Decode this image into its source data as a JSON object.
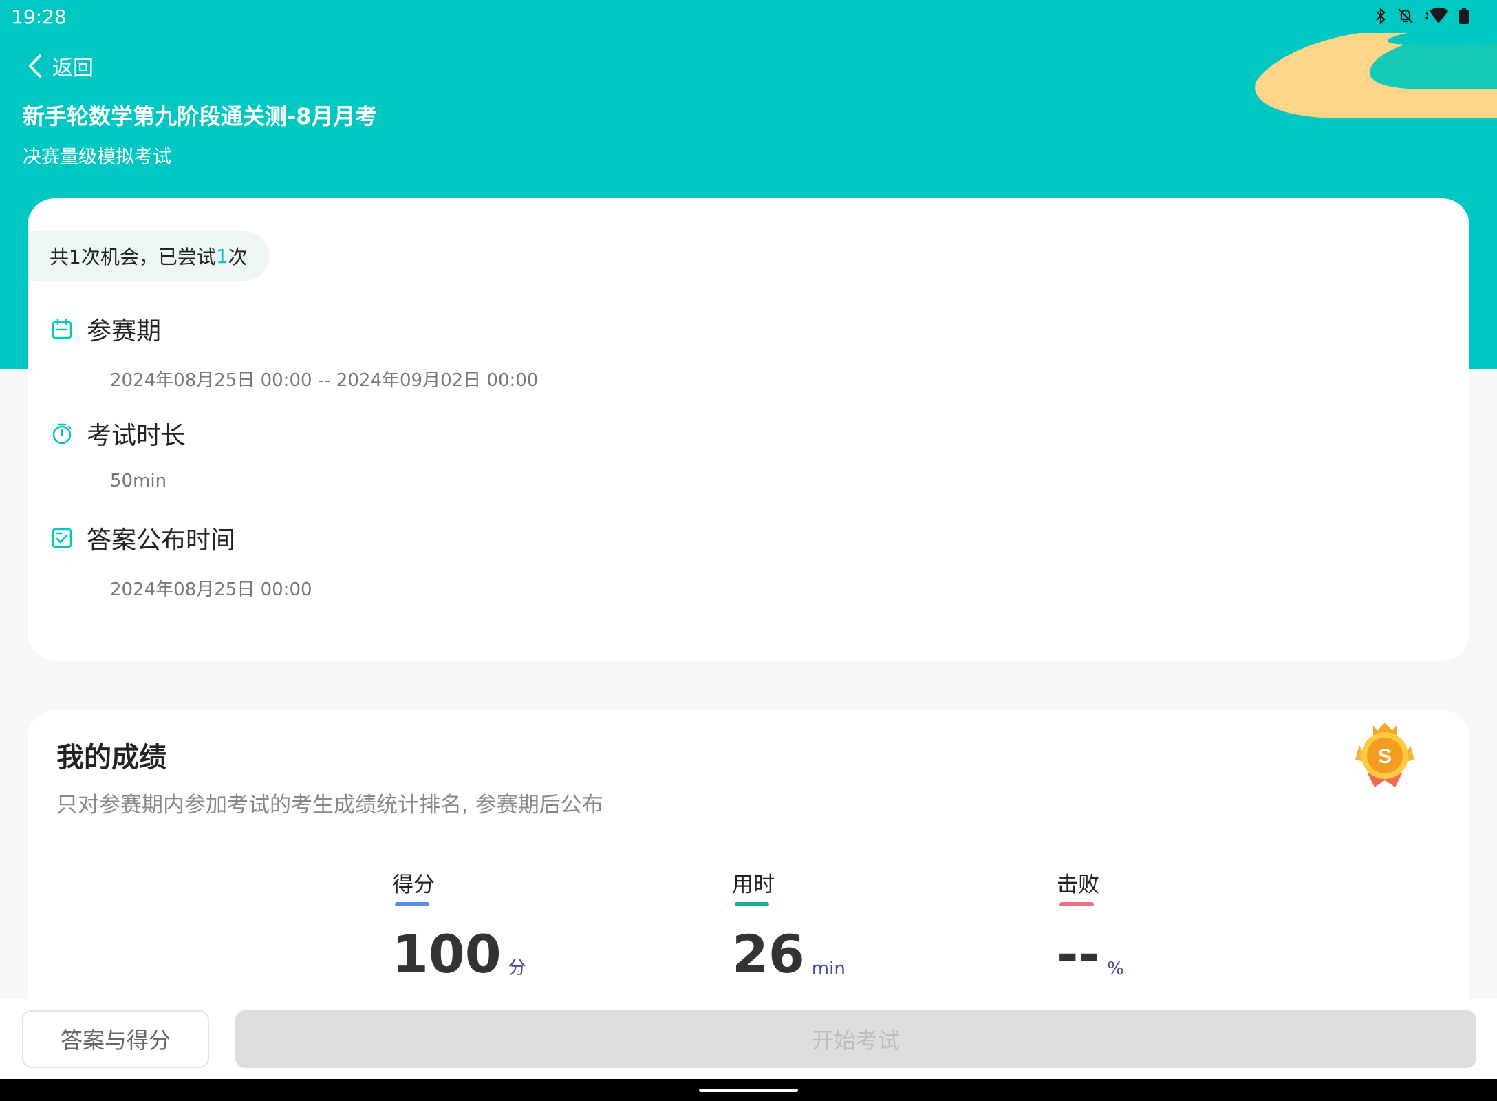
{
  "status_bar": {
    "time": "19:28",
    "icons": [
      "bluetooth-icon",
      "notifications-off-icon",
      "wifi-icon",
      "battery-icon"
    ]
  },
  "nav": {
    "back_label": "返回"
  },
  "header": {
    "title": "新手轮数学第九阶段通关测-8月月考",
    "subtitle": "决赛量级模拟考试"
  },
  "attempts": {
    "prefix": "共1次机会，已尝试",
    "count": "1",
    "suffix": "次"
  },
  "info": [
    {
      "icon": "calendar-icon",
      "title": "参赛期",
      "value": "2024年08月25日 00:00 -- 2024年09月02日 00:00"
    },
    {
      "icon": "stopwatch-icon",
      "title": "考试时长",
      "value": "50min"
    },
    {
      "icon": "checklist-icon",
      "title": "答案公布时间",
      "value": "2024年08月25日 00:00"
    }
  ],
  "score": {
    "title": "我的成绩",
    "description": "只对参赛期内参加考试的考生成绩统计排名, 参赛期后公布",
    "medal_letter": "S",
    "stats": [
      {
        "label": "得分",
        "value": "100",
        "unit": "分",
        "color": "#5b8def"
      },
      {
        "label": "用时",
        "value": "26",
        "unit": "min",
        "color": "#17b58a"
      },
      {
        "label": "击败",
        "value": "--",
        "unit": "%",
        "color": "#f06b8a"
      }
    ]
  },
  "actions": {
    "answers_label": "答案与得分",
    "start_label": "开始考试"
  },
  "colors": {
    "primary": "#00c7c2",
    "background": "#f5f7f9",
    "disabled_button": "#dedede"
  }
}
